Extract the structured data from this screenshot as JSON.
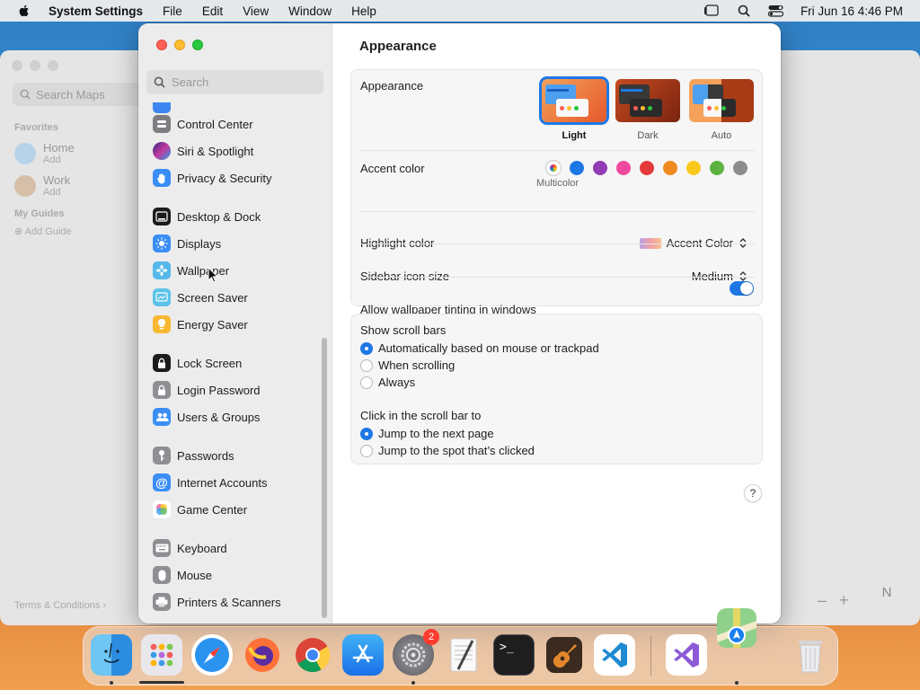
{
  "menubar": {
    "app_name": "System Settings",
    "menus": [
      "File",
      "Edit",
      "View",
      "Window",
      "Help"
    ],
    "clock": "Fri Jun 16  4:46 PM"
  },
  "maps": {
    "search_placeholder": "Search Maps",
    "favorites_heading": "Favorites",
    "favorites": [
      {
        "title": "Home",
        "subtitle": "Add"
      },
      {
        "title": "Work",
        "subtitle": "Add"
      }
    ],
    "guides_heading": "My Guides",
    "add_guide": "Add Guide",
    "terms": "Terms & Conditions",
    "compass": "N"
  },
  "sidebar": {
    "search_placeholder": "Search",
    "items": [
      {
        "label": "Control Center",
        "icon": "control-center-icon"
      },
      {
        "label": "Siri & Spotlight",
        "icon": "siri-icon"
      },
      {
        "label": "Privacy & Security",
        "icon": "hand-icon"
      },
      {
        "label": "Desktop & Dock",
        "icon": "desktop-dock-icon"
      },
      {
        "label": "Displays",
        "icon": "sun-icon"
      },
      {
        "label": "Wallpaper",
        "icon": "flower-icon"
      },
      {
        "label": "Screen Saver",
        "icon": "screen-saver-icon"
      },
      {
        "label": "Energy Saver",
        "icon": "lightbulb-icon"
      },
      {
        "label": "Lock Screen",
        "icon": "lock-icon"
      },
      {
        "label": "Login Password",
        "icon": "padlock-icon"
      },
      {
        "label": "Users & Groups",
        "icon": "users-icon"
      },
      {
        "label": "Passwords",
        "icon": "key-icon"
      },
      {
        "label": "Internet Accounts",
        "icon": "at-icon"
      },
      {
        "label": "Game Center",
        "icon": "game-center-icon"
      },
      {
        "label": "Keyboard",
        "icon": "keyboard-icon"
      },
      {
        "label": "Mouse",
        "icon": "mouse-icon"
      },
      {
        "label": "Printers & Scanners",
        "icon": "printer-icon"
      }
    ]
  },
  "main": {
    "title": "Appearance",
    "appearance": {
      "label": "Appearance",
      "options": [
        "Light",
        "Dark",
        "Auto"
      ],
      "selected": "Light"
    },
    "accent": {
      "label": "Accent color",
      "selected_caption": "Multicolor",
      "colors": [
        "#1e78e4",
        "#943cb5",
        "#f04aa0",
        "#e3393a",
        "#f18a1e",
        "#fbc91c",
        "#5db23f",
        "#8c8c8c"
      ]
    },
    "highlight": {
      "label": "Highlight color",
      "value": "Accent Color"
    },
    "sidebar_icon": {
      "label": "Sidebar icon size",
      "value": "Medium"
    },
    "tinting": {
      "label": "Allow wallpaper tinting in windows",
      "on": true
    },
    "scrollbars": {
      "heading": "Show scroll bars",
      "options": [
        "Automatically based on mouse or trackpad",
        "When scrolling",
        "Always"
      ],
      "selected_index": 0
    },
    "click_scroll": {
      "heading": "Click in the scroll bar to",
      "options": [
        "Jump to the next page",
        "Jump to the spot that’s clicked"
      ],
      "selected_index": 0
    },
    "help": "?"
  },
  "dock": {
    "apps": [
      "Finder",
      "Launchpad",
      "Safari",
      "Firefox",
      "Chrome",
      "App Store",
      "System Settings",
      "TextEdit",
      "Terminal",
      "GarageBand",
      "Visual Studio Code",
      "Visual Studio",
      "Trash"
    ],
    "settings_badge": "2"
  }
}
